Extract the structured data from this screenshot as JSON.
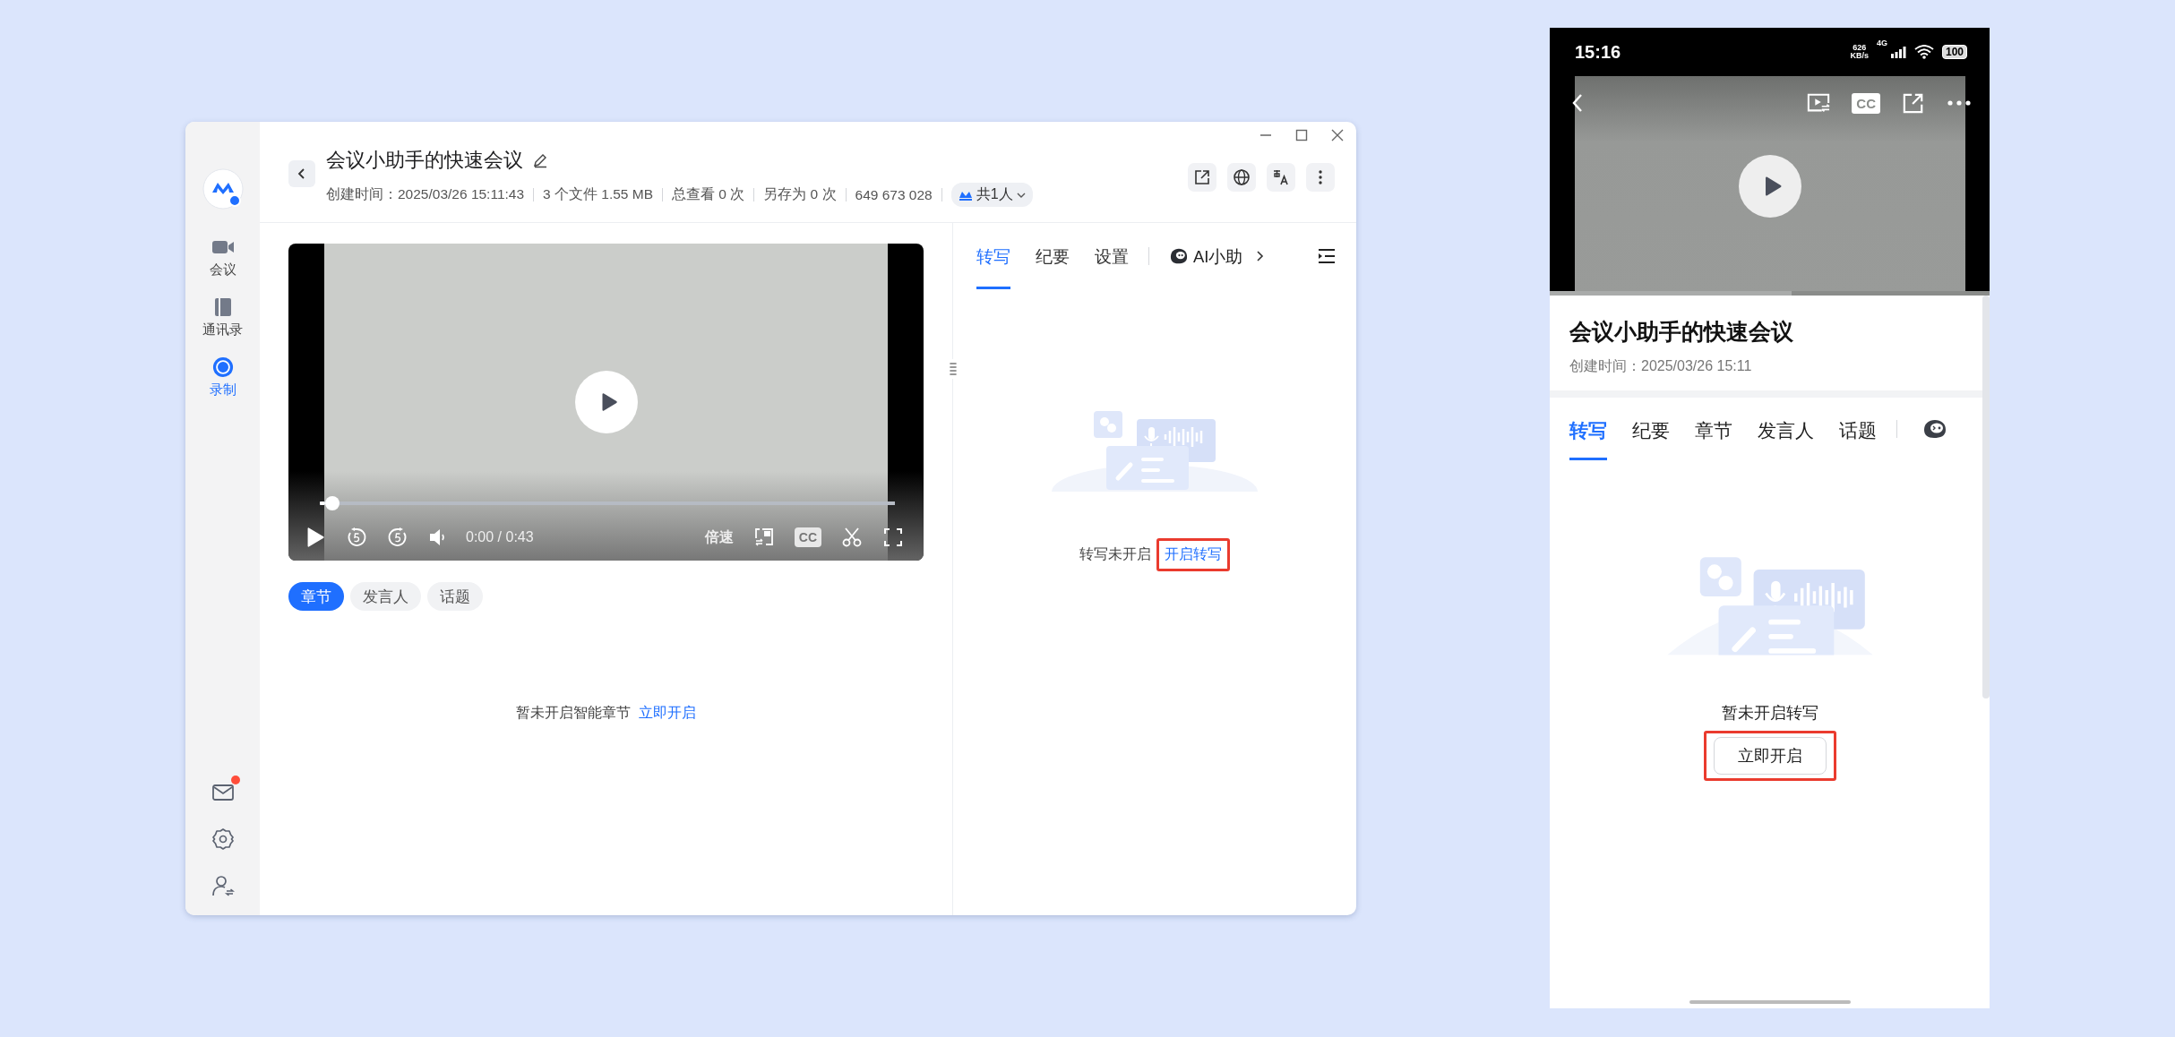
{
  "desktop": {
    "sidebar": {
      "items": [
        {
          "kind": "camera",
          "label": "会议",
          "selected": false
        },
        {
          "kind": "book",
          "label": "通讯录",
          "selected": false
        },
        {
          "kind": "record",
          "label": "录制",
          "selected": true
        }
      ],
      "mail_unread": true
    },
    "header": {
      "title": "会议小助手的快速会议",
      "meta": [
        "创建时间：2025/03/26 15:11:43",
        "3 个文件 1.55 MB",
        "总查看 0 次",
        "另存为 0 次",
        "649 673 028"
      ],
      "share": "共1人"
    },
    "player": {
      "level": 0.01,
      "time": "0:00 / 0:43",
      "speed": "倍速",
      "cc": "CC"
    },
    "chips": [
      {
        "label": "章节",
        "selected": true
      },
      {
        "label": "发言人",
        "selected": false
      },
      {
        "label": "话题",
        "selected": false
      }
    ],
    "chapters_empty": {
      "text": "暂未开启智能章节",
      "link": "立即开启"
    },
    "tabs": [
      {
        "label": "转写",
        "selected": true
      },
      {
        "label": "纪要",
        "selected": false
      },
      {
        "label": "设置",
        "selected": false
      }
    ],
    "assistant_tab": "AI小助",
    "transcript_empty": {
      "text": "转写未开启",
      "link": "开启转写",
      "highlighted": true
    }
  },
  "phone": {
    "status": {
      "time": "15:16",
      "speed": "626",
      "speed_unit": "KB/s",
      "network": "4G",
      "battery": "100"
    },
    "player": {
      "cc": "CC",
      "level": 0.55
    },
    "title": "会议小助手的快速会议",
    "created": "创建时间：2025/03/26 15:11",
    "tabs": [
      {
        "label": "转写",
        "selected": true
      },
      {
        "label": "纪要",
        "selected": false
      },
      {
        "label": "章节",
        "selected": false
      },
      {
        "label": "发言人",
        "selected": false
      },
      {
        "label": "话题",
        "selected": false
      }
    ],
    "transcript_empty": {
      "text": "暂未开启转写",
      "button": "立即开启",
      "highlighted": true
    }
  }
}
